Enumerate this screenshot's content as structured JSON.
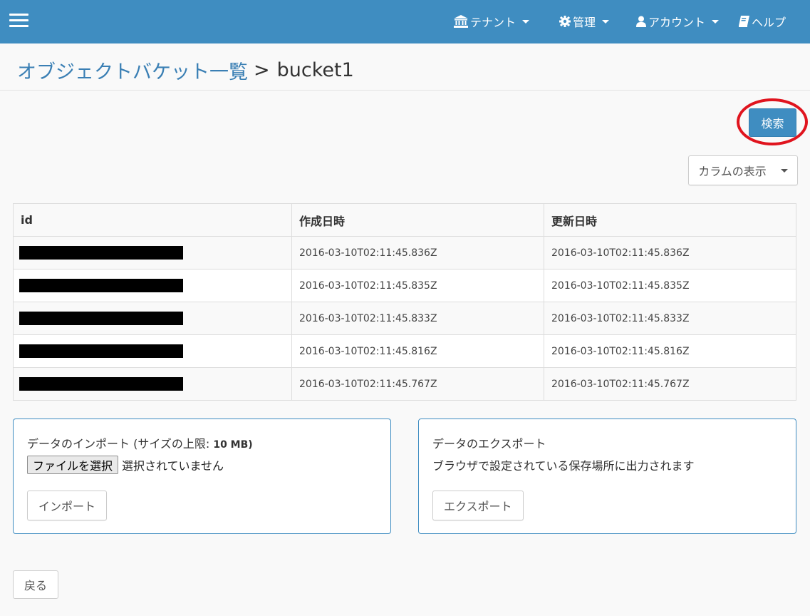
{
  "navbar": {
    "items": [
      {
        "label": "テナント",
        "icon": "bank-icon",
        "has_caret": true
      },
      {
        "label": "管理",
        "icon": "gear-icon",
        "has_caret": true
      },
      {
        "label": "アカウント",
        "icon": "user-icon",
        "has_caret": true
      },
      {
        "label": "ヘルプ",
        "icon": "book-icon",
        "has_caret": false
      }
    ],
    "background": "#3f8dc1"
  },
  "header": {
    "breadcrumb_link": "オブジェクトバケット一覧",
    "separator": ">",
    "current": "bucket1"
  },
  "toolbar": {
    "search_label": "検索",
    "columns_label": "カラムの表示"
  },
  "table": {
    "columns": [
      "id",
      "作成日時",
      "更新日時"
    ],
    "rows": [
      {
        "id": "",
        "created": "2016-03-10T02:11:45.836Z",
        "updated": "2016-03-10T02:11:45.836Z"
      },
      {
        "id": "",
        "created": "2016-03-10T02:11:45.835Z",
        "updated": "2016-03-10T02:11:45.835Z"
      },
      {
        "id": "",
        "created": "2016-03-10T02:11:45.833Z",
        "updated": "2016-03-10T02:11:45.833Z"
      },
      {
        "id": "",
        "created": "2016-03-10T02:11:45.816Z",
        "updated": "2016-03-10T02:11:45.816Z"
      },
      {
        "id": "",
        "created": "2016-03-10T02:11:45.767Z",
        "updated": "2016-03-10T02:11:45.767Z"
      }
    ]
  },
  "import_panel": {
    "title": "データのインポート (サイズの上限: ",
    "limit": "10 MB)",
    "file_button": "ファイルを選択",
    "file_status": "選択されていません",
    "button": "インポート"
  },
  "export_panel": {
    "title": "データのエクスポート",
    "description": "ブラウザで設定されている保存場所に出力されます",
    "button": "エクスポート"
  },
  "footer": {
    "back_label": "戻る"
  },
  "colors": {
    "accent": "#3f8dc1",
    "highlight": "#e0141e"
  }
}
